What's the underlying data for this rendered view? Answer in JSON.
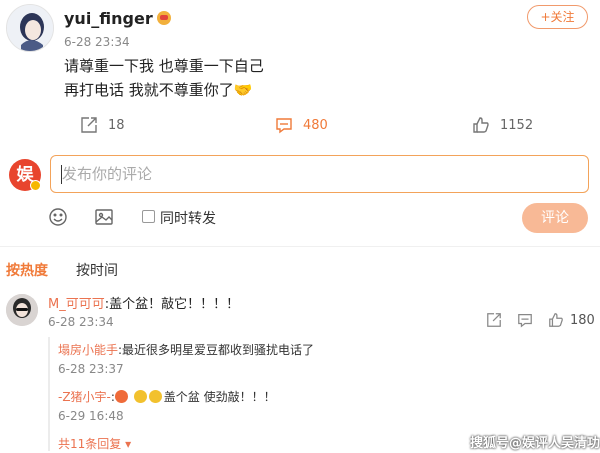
{
  "post": {
    "username": "yui_finger",
    "time": "6-28 23:34",
    "lines": [
      "请尊重一下我 也尊重一下自己",
      "再打电话 我就不尊重你了🤝"
    ],
    "follow_label": "+关注",
    "actions": {
      "repost": "18",
      "comment": "480",
      "like": "1152"
    }
  },
  "composer": {
    "avatar_char": "娱",
    "placeholder": "发布你的评论",
    "sync_label": "同时转发",
    "submit_label": "评论"
  },
  "sort": {
    "hot": "按热度",
    "time": "按时间"
  },
  "comment": {
    "user": "M_可可可",
    "text": ":盖个盆！敲它！！！！",
    "time": "6-28 23:34",
    "likes": "180",
    "replies": [
      {
        "user": "塌房小能手",
        "text": ":最近很多明星爱豆都收到骚扰电话了",
        "time": "6-28 23:37"
      },
      {
        "user": "-Z猪小宇-",
        "text": ":盖个盆 使劲敲！！！",
        "time": "6-29 16:48"
      }
    ],
    "more": "共11条回复"
  },
  "watermark": "搜狐号@娱评人吴清功",
  "colors": {
    "accent": "#f07a39",
    "username_link": "#eb7350",
    "submit_bg": "#f8b996"
  }
}
